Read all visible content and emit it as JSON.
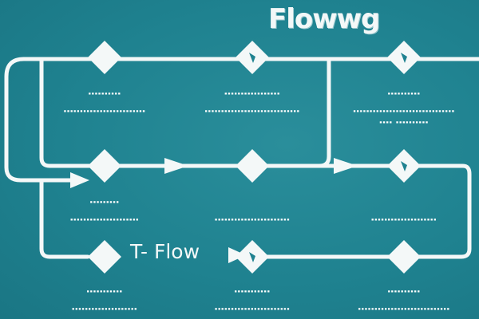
{
  "title": "Flowwg",
  "subtitle": "T- Flow",
  "colors": {
    "background": "#1f8290",
    "line": "#f4f8f8",
    "accent": "#1f8290"
  },
  "nodes": [
    {
      "id": "r1c1",
      "row": 1,
      "col": 1,
      "mark": false,
      "caption": "▪▪▪▪▪▪▪▪▪▪",
      "desc": "▪▪▪▪▪▪▪▪▪▪▪▪▪▪▪▪▪▪▪▪▪▪▪▪▪"
    },
    {
      "id": "r1c2",
      "row": 1,
      "col": 2,
      "mark": true,
      "caption": "▪▪▪▪▪▪▪▪▪▪▪▪▪▪▪▪▪",
      "desc": "▪▪▪▪▪▪▪▪▪▪▪▪▪▪▪▪▪▪▪▪▪▪▪▪▪▪▪▪▪"
    },
    {
      "id": "r1c3",
      "row": 1,
      "col": 3,
      "mark": true,
      "caption": "▪▪▪▪▪▪▪▪▪▪",
      "desc": "▪▪▪▪▪▪▪▪▪▪▪▪▪▪▪▪▪▪▪▪▪▪▪▪▪▪▪▪▪▪▪",
      "desc2": "▪▪▪▪ ▪▪▪▪▪▪▪▪▪▪"
    },
    {
      "id": "r2c1",
      "row": 2,
      "col": 1,
      "mark": false,
      "caption": "▪▪▪▪▪▪▪▪▪",
      "desc": "▪▪▪▪▪▪▪▪▪▪▪▪▪▪▪▪▪▪▪▪▪"
    },
    {
      "id": "r2c2",
      "row": 2,
      "col": 2,
      "mark": false,
      "caption": "",
      "desc": "▪▪▪▪▪▪▪▪▪▪▪▪▪▪▪▪▪▪▪▪▪▪▪"
    },
    {
      "id": "r2c3",
      "row": 2,
      "col": 3,
      "mark": true,
      "caption": "",
      "desc": "▪▪▪▪▪▪▪▪▪▪▪▪▪▪▪▪▪▪▪▪"
    },
    {
      "id": "r3c1",
      "row": 3,
      "col": 1,
      "mark": false,
      "caption": "▪▪▪▪▪▪▪▪▪▪▪",
      "desc": "▪▪▪▪▪▪▪▪▪▪▪▪▪▪▪▪▪▪▪▪"
    },
    {
      "id": "r3c2",
      "row": 3,
      "col": 2,
      "mark": true,
      "caption": "▪▪▪▪▪▪▪▪▪▪▪",
      "desc": "▪▪▪▪▪▪▪▪▪▪▪▪▪▪▪▪▪▪▪▪▪▪▪"
    },
    {
      "id": "r3c3",
      "row": 3,
      "col": 3,
      "mark": false,
      "caption": "▪▪▪▪▪▪▪▪▪▪",
      "desc": "▪▪▪▪▪▪▪▪▪▪▪▪▪▪▪▪▪▪▪▪▪▪▪▪▪▪▪▪"
    }
  ]
}
